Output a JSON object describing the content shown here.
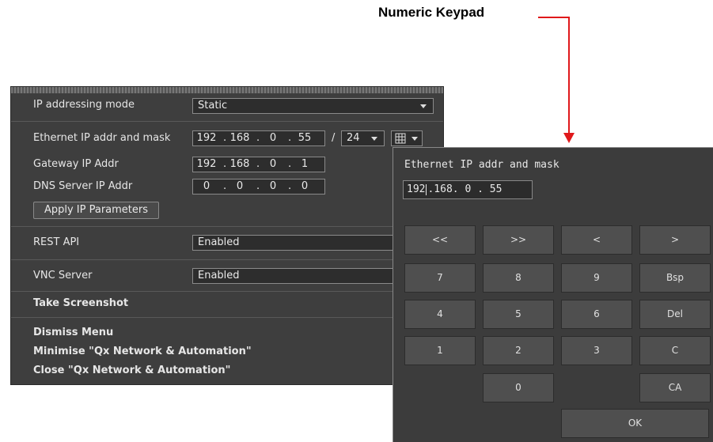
{
  "callout": {
    "label": "Numeric Keypad",
    "arrow_color": "#e0191b"
  },
  "menu": {
    "ip_mode": {
      "label": "IP addressing mode",
      "value": "Static"
    },
    "ethernet": {
      "label": "Ethernet IP addr and mask",
      "octets": [
        "192",
        "168",
        "0",
        "55"
      ],
      "mask": "24",
      "keypad_icon": "keypad-grid-icon"
    },
    "gateway": {
      "label": "Gateway IP Addr",
      "octets": [
        "192",
        "168",
        "0",
        "1"
      ]
    },
    "dns": {
      "label": "DNS Server IP Addr",
      "octets": [
        "0",
        "0",
        "0",
        "0"
      ]
    },
    "apply_label": "Apply IP Parameters",
    "rest_api": {
      "label": "REST API",
      "value": "Enabled"
    },
    "vnc": {
      "label": "VNC Server",
      "value": "Enabled"
    },
    "screenshot_label": "Take Screenshot",
    "dismiss_label": "Dismiss Menu",
    "minimise_label": "Minimise \"Qx Network & Automation\"",
    "close_label": "Close \"Qx Network & Automation\""
  },
  "keypad": {
    "title": "Ethernet IP addr and mask",
    "input_before_cursor": "192",
    "input_after_cursor": ".168. 0 . 55",
    "keys": {
      "first": "<<",
      "last": ">>",
      "left": "<",
      "right": ">",
      "k7": "7",
      "k8": "8",
      "k9": "9",
      "bsp": "Bsp",
      "k4": "4",
      "k5": "5",
      "k6": "6",
      "del": "Del",
      "k1": "1",
      "k2": "2",
      "k3": "3",
      "c": "C",
      "k0": "0",
      "ca": "CA",
      "ok": "OK"
    }
  }
}
